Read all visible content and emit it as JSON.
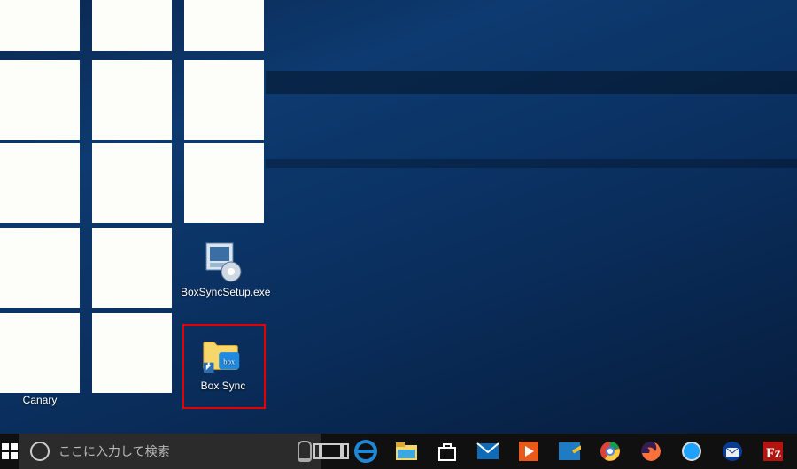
{
  "search": {
    "placeholder": "ここに入力して検索"
  },
  "desktop": {
    "icons": {
      "boxsyncsetup": {
        "label": "BoxSyncSetup.exe"
      },
      "boxsync": {
        "label": "Box Sync"
      },
      "canary": {
        "label": "Canary"
      }
    }
  },
  "taskbar": {
    "pinned": [
      {
        "name": "edge",
        "color": "#1e87d6"
      },
      {
        "name": "explorer",
        "color": "#f5c04a"
      },
      {
        "name": "store",
        "color": "#ffffff"
      },
      {
        "name": "mail",
        "color": "#0f6bb8"
      },
      {
        "name": "movies",
        "color": "#e85a1a"
      },
      {
        "name": "paint",
        "color": "#1f7bc2"
      },
      {
        "name": "chrome",
        "color": "#ffffff"
      },
      {
        "name": "firefox",
        "color": "#ffffff"
      },
      {
        "name": "safari",
        "color": "#ffffff"
      },
      {
        "name": "thunderbird",
        "color": "#ffffff"
      },
      {
        "name": "filezilla",
        "color": "#b3140f"
      }
    ]
  }
}
